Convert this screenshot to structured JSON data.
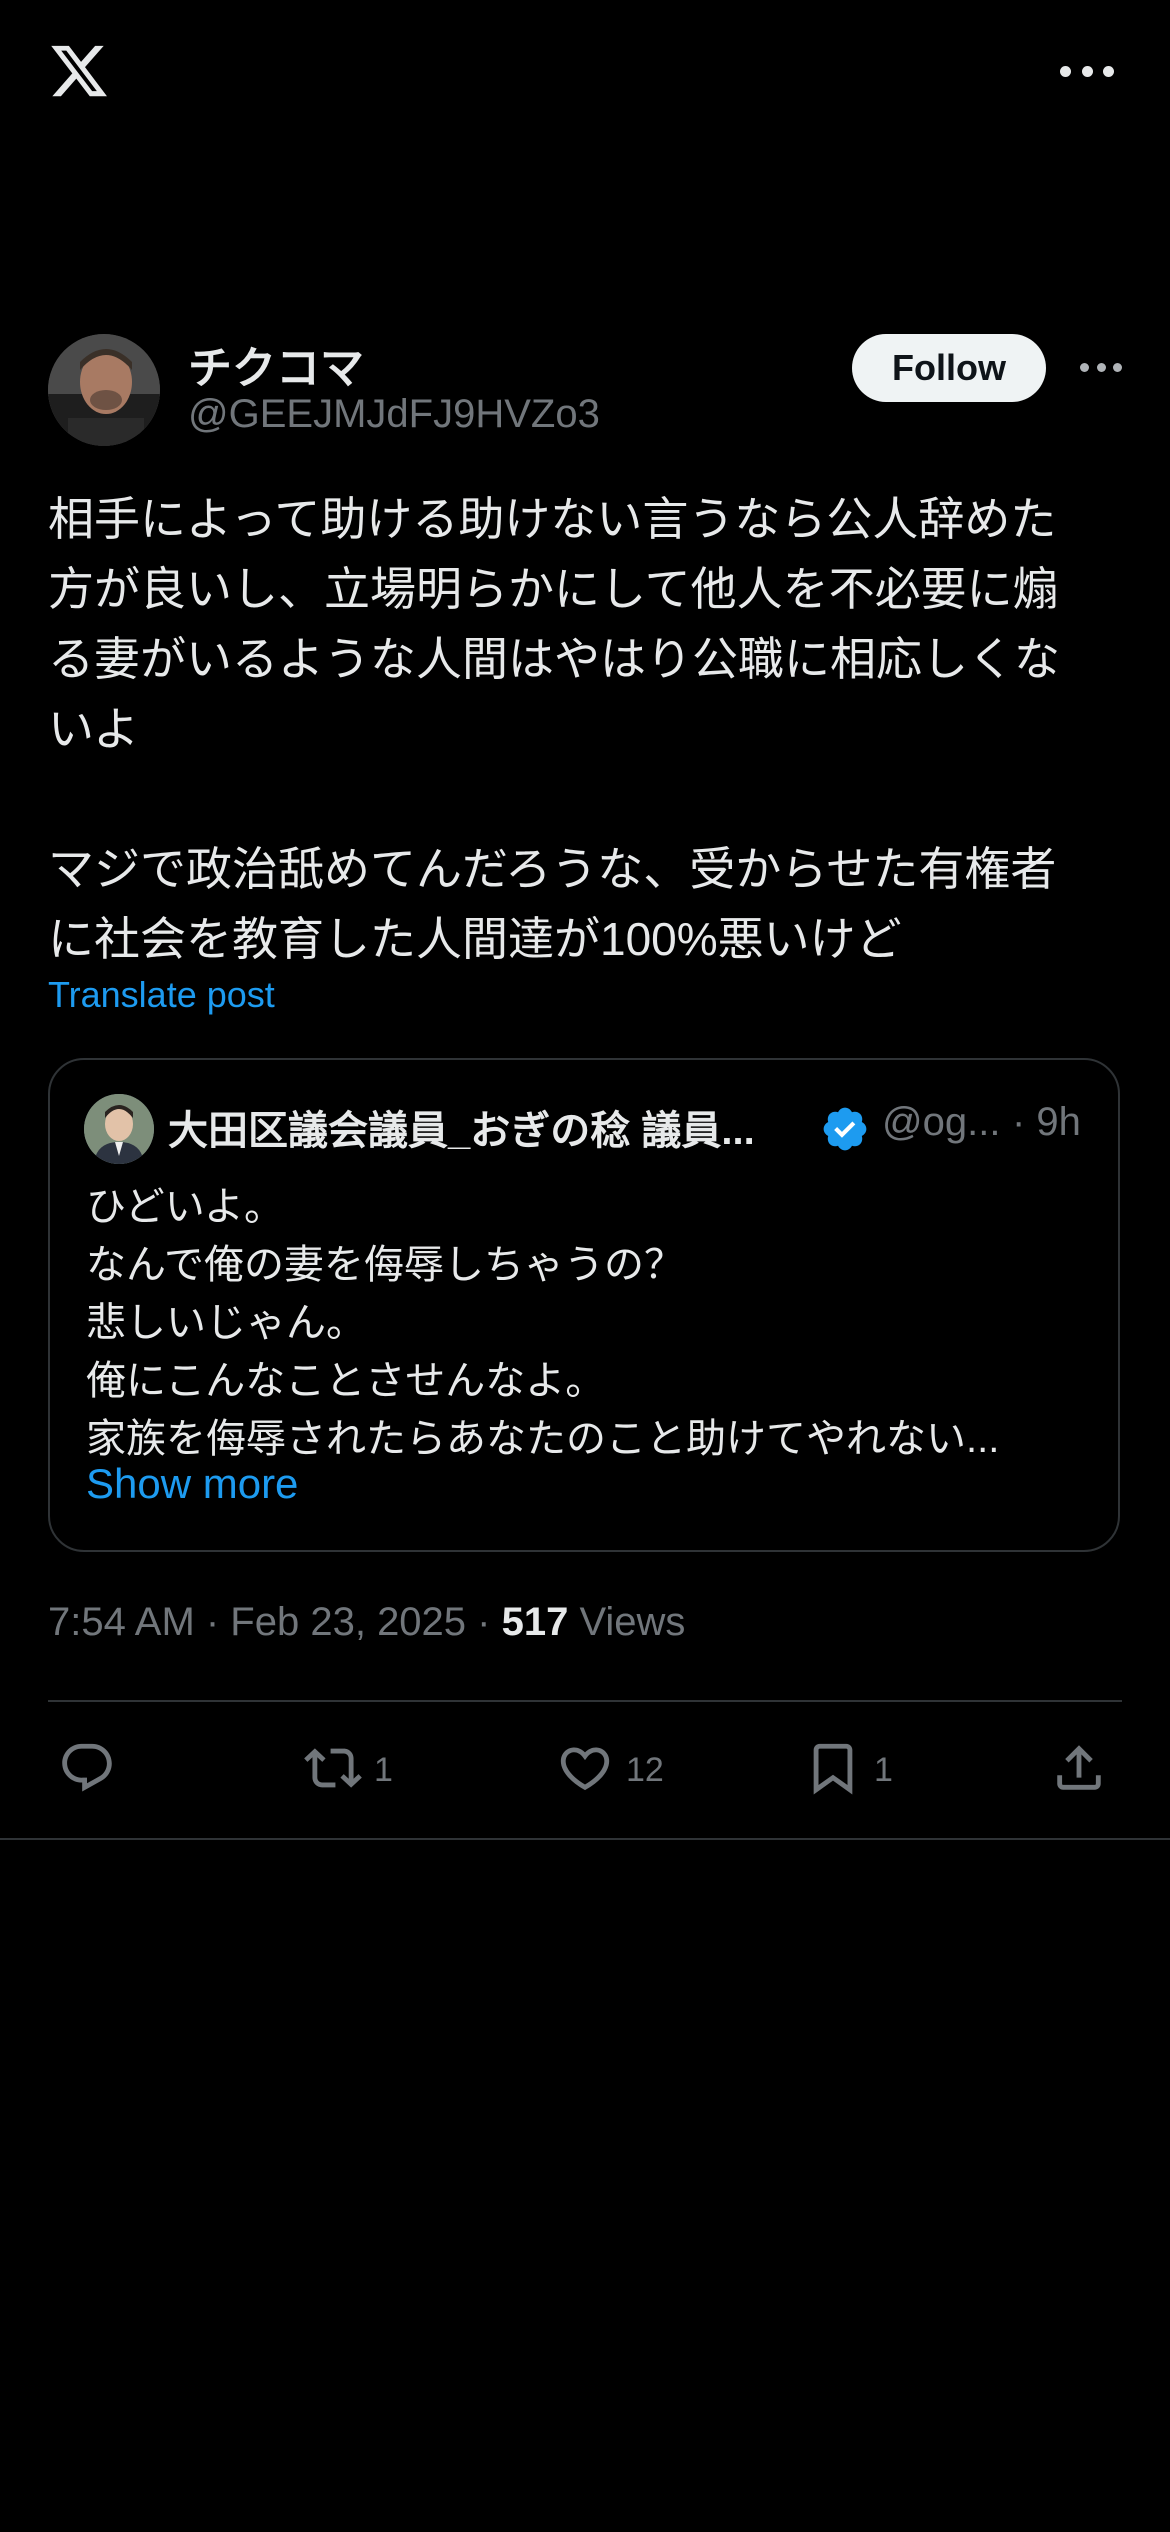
{
  "header": {
    "logo_icon": "x-logo-icon",
    "menu_icon": "more-horizontal-icon"
  },
  "post": {
    "author": {
      "display_name": "チクコマ",
      "handle": "@GEEJMJdFJ9HVZo3",
      "follow_label": "Follow"
    },
    "text": "相手によって助ける助けない言うなら公人辞めた\n方が良いし、立場明らかにして他人を不必要に煽\nる妻がいるような人間はやはり公職に相応しくな\nいよ\n\nマジで政治舐めてんだろうな、受からせた有権者\nに社会を教育した人間達が100%悪いけど",
    "translate_label": "Translate post",
    "timestamp": "7:54 AM · Feb 23, 2025 · ",
    "views_count": "517",
    "views_label": " Views",
    "actions": {
      "reply_count": "",
      "repost_count": "1",
      "like_count": "12",
      "bookmark_count": "1"
    }
  },
  "quote": {
    "display_name": "大田区議会議員_おぎの稔 議員...",
    "handle": "@og...",
    "time": "· 9h",
    "lines": [
      "ひどいよ。",
      "なんで俺の妻を侮辱しちゃうの？",
      "悲しいじゃん。",
      "俺にこんなことさせんなよ。",
      "家族を侮辱されたらあなたのこと助けてやれない..."
    ],
    "show_more_label": "Show more"
  },
  "colors": {
    "background": "#000000",
    "accent": "#1d9bf0",
    "text": "#e7e9ea",
    "muted": "#71767b",
    "border": "#2f3336"
  }
}
